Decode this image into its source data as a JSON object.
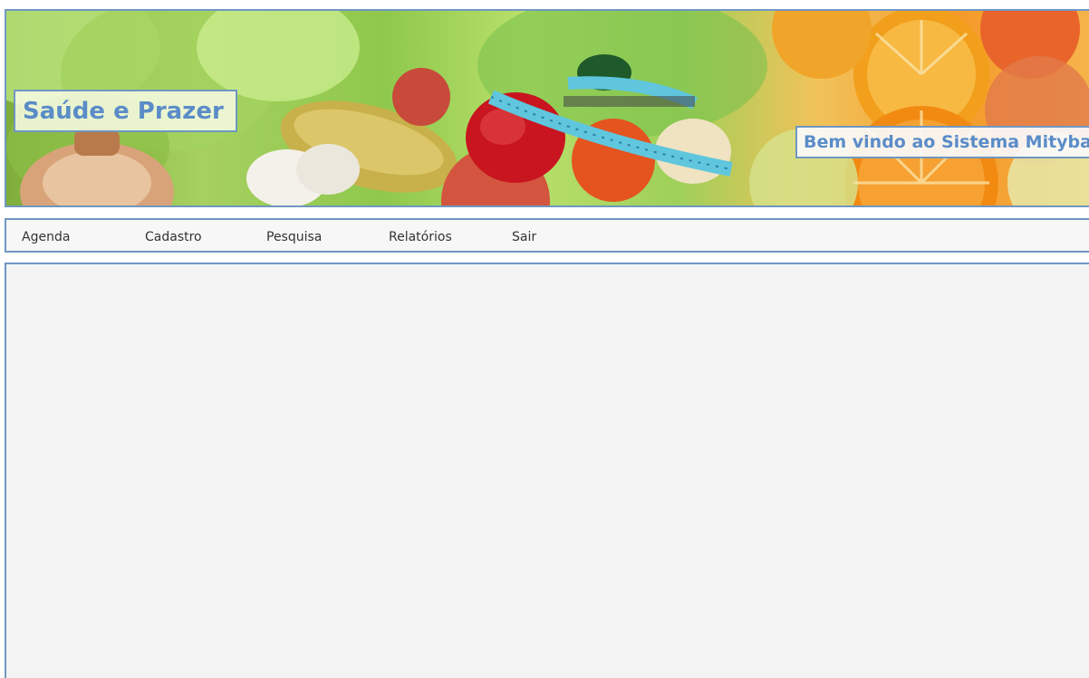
{
  "header": {
    "title": "Saúde e Prazer",
    "welcome": "Bem vindo ao Sistema Mityba",
    "banner_image": "vegetables-fruits-measuring-tape-banner"
  },
  "menu": {
    "items": [
      {
        "label": "Agenda"
      },
      {
        "label": "Cadastro"
      },
      {
        "label": "Pesquisa"
      },
      {
        "label": "Relatórios"
      },
      {
        "label": "Sair"
      }
    ]
  },
  "colors": {
    "border": "#6f97c2",
    "title_text": "#5b8cc8",
    "content_background": "#f3f3f3"
  }
}
